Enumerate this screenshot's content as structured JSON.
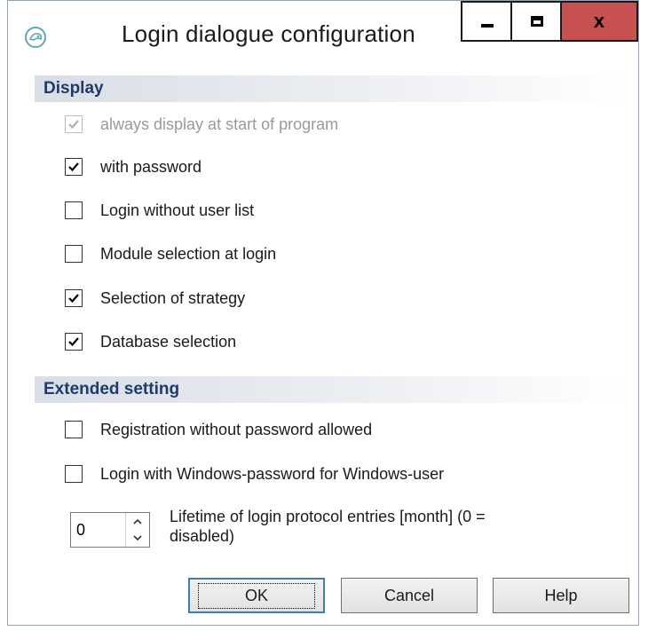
{
  "window": {
    "title": "Login dialogue configuration",
    "close_glyph": "x"
  },
  "display": {
    "header": "Display",
    "items": [
      {
        "label": "always display at start of program",
        "checked": true,
        "disabled": true
      },
      {
        "label": "with password",
        "checked": true,
        "disabled": false
      },
      {
        "label": "Login without user list",
        "checked": false,
        "disabled": false
      },
      {
        "label": "Module selection at login",
        "checked": false,
        "disabled": false
      },
      {
        "label": "Selection of strategy",
        "checked": true,
        "disabled": false
      },
      {
        "label": "Database selection",
        "checked": true,
        "disabled": false
      }
    ]
  },
  "extended": {
    "header": "Extended setting",
    "items": [
      {
        "label": "Registration without password allowed",
        "checked": false
      },
      {
        "label": "Login with Windows-password for Windows-user",
        "checked": false
      }
    ],
    "spinner": {
      "value": "0",
      "label": "Lifetime of login protocol entries  [month] (0 = disabled)"
    }
  },
  "buttons": {
    "ok": "OK",
    "cancel": "Cancel",
    "help": "Help"
  },
  "colors": {
    "close_button": "#c75050",
    "header_text": "#1e3a6e",
    "default_button_border": "#3c7fb1"
  },
  "icons": {
    "app": "app-logo-icon",
    "minimize": "minimize-icon",
    "maximize": "maximize-icon",
    "close": "close-icon",
    "check": "checkmark-icon"
  }
}
